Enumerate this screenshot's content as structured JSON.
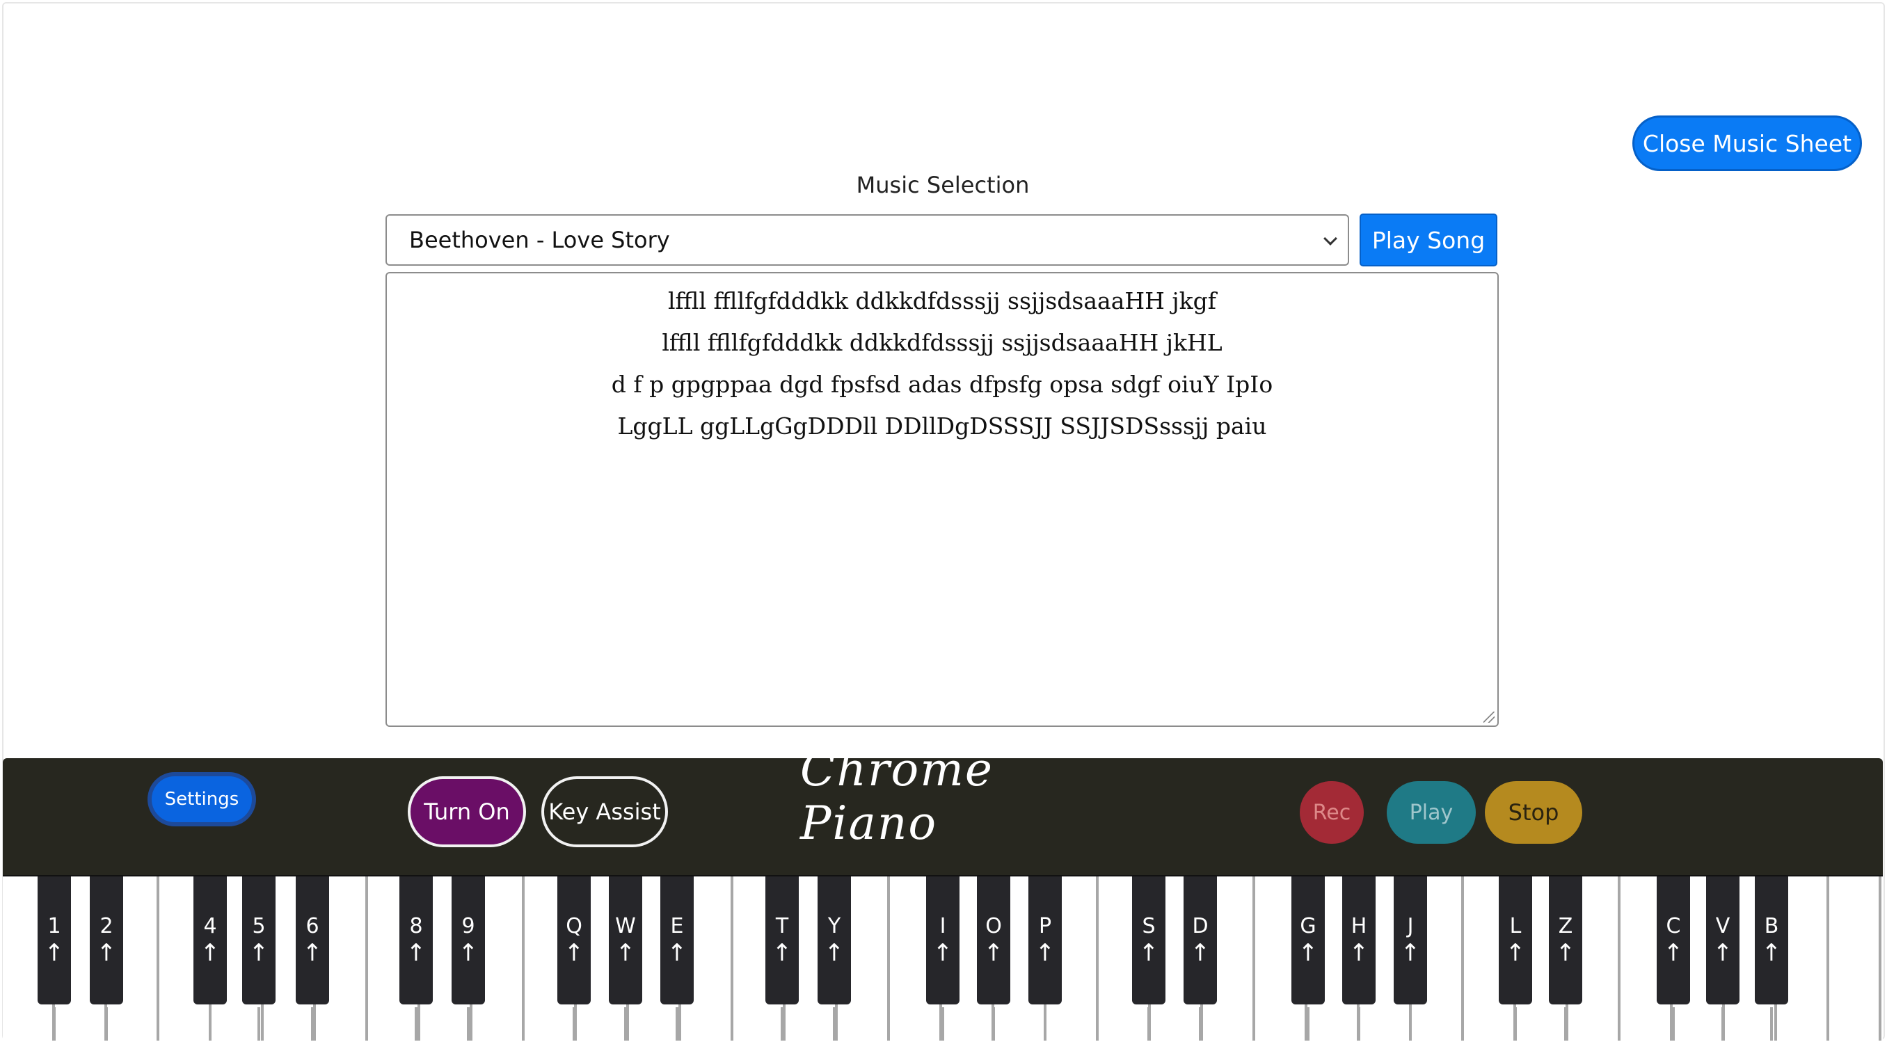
{
  "header": {
    "close_button_label": "Close Music Sheet"
  },
  "music_selection": {
    "label": "Music Selection",
    "selected_song": "Beethoven - Love Story",
    "play_button_label": "Play Song"
  },
  "sheet": {
    "lines": [
      "lffll ffllfgfdddkk ddkkdfdsssjj ssjjsdsaaaHH jkgf",
      "lffll ffllfgfdddkk ddkkdfdsssjj ssjjsdsaaaHH jkHL",
      "d f p gpgppaa dgd fpsfsd adas dfpsfg opsa sdgf oiuY IpIo",
      "LggLL ggLLgGgDDDll DDllDgDSSSJJ SSJJSDSsssjj paiu"
    ]
  },
  "controls": {
    "settings_label": "Settings",
    "turn_on_label": "Turn On",
    "key_assist_label": "Key Assist",
    "logo_text": "Chrome Piano",
    "rec_label": "Rec",
    "play_label": "Play",
    "stop_label": "Stop"
  },
  "keyboard": {
    "arrow_glyph": "↑",
    "black_keys": [
      "1",
      "2",
      "4",
      "5",
      "6",
      "8",
      "9",
      "Q",
      "W",
      "E",
      "T",
      "Y",
      "I",
      "O",
      "P",
      "S",
      "D",
      "G",
      "H",
      "J",
      "L",
      "Z",
      "C",
      "V",
      "B"
    ]
  },
  "colors": {
    "accent_blue": "#0a7bf5",
    "turn_on_purple": "#6a0e66",
    "rec_red": "#a32a36",
    "play_teal": "#1f7a86",
    "stop_gold": "#b58a1f",
    "bar_dark": "#27271f"
  }
}
